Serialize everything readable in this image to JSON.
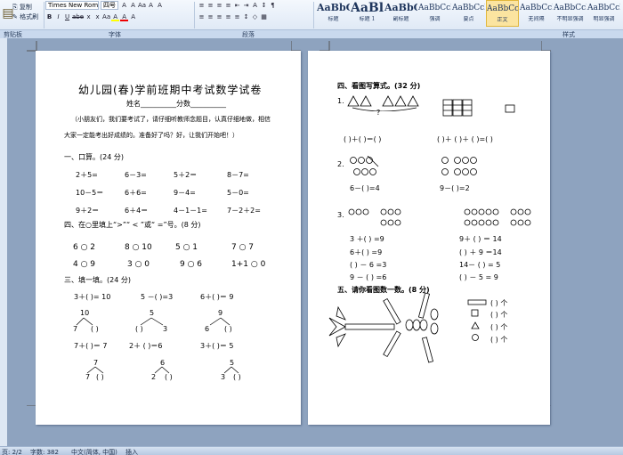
{
  "ribbon": {
    "paste_label": "粘贴",
    "copy_label": "复制",
    "format_painter_label": "格式刷",
    "font_name": "Times New Roman",
    "font_size": "四号",
    "groups": [
      "剪贴板",
      "字体",
      "段落",
      "样式"
    ],
    "font_buttons_row1": [
      "A",
      "A",
      "Aa",
      "A",
      "A"
    ],
    "font_buttons_row2": [
      "B",
      "I",
      "U",
      "abe",
      "x",
      "x",
      "Aa",
      "A",
      "A",
      "A"
    ],
    "para_buttons_row1": [
      "≡",
      "≡",
      "≡",
      "≡",
      "⇤",
      "⇥",
      "A",
      "↕",
      "¶"
    ],
    "para_buttons_row2": [
      "≡",
      "≡",
      "≡",
      "≡",
      "≡",
      "↕",
      "◇",
      "▦"
    ],
    "styles": [
      {
        "sample": "AaBbC",
        "name": "标题"
      },
      {
        "sample": "AaBl",
        "name": "标题 1"
      },
      {
        "sample": "AaBbC",
        "name": "副标题"
      },
      {
        "sample": "AaBbCcDı",
        "name": "强调"
      },
      {
        "sample": "AaBbCcD",
        "name": "要点"
      },
      {
        "sample": "AaBbCcD",
        "name": "正文"
      },
      {
        "sample": "AaBbCcDı",
        "name": "无间隔"
      },
      {
        "sample": "AaBbCcDı",
        "name": "不明显强调"
      },
      {
        "sample": "AaBbCcD",
        "name": "明显强调"
      }
    ]
  },
  "page1": {
    "title": "幼儿园(春)学前班期中考试数学试卷",
    "name_line": "姓名__________分数__________",
    "intro1": "（小朋友们，我们要考试了，请仔细听教师念题目，认真仔细地做，相信",
    "intro2": "大家一定能考出好成绩的。准备好了吗？好，让我们开始吧！）",
    "s1": "一、口算。(24 分)",
    "calc": [
      [
        "2＋5=",
        "6－3=",
        "5＋2＝",
        "8－7="
      ],
      [
        "10－5＝",
        "6＋6=",
        "9－4=",
        "5－0="
      ],
      [
        "9＋2＝",
        "6＋4＝",
        "4－1－1=",
        "7－2＋2="
      ]
    ],
    "s2": "四、在○里填上“>”“ < ”或“ =”号。(8 分)",
    "cmp": [
      [
        "6 ○ 2",
        "8 ○ 10",
        "5 ○  1",
        "7 ○ 7"
      ],
      [
        "4 ○ 9",
        "3 ○ 0",
        "9 ○ 6",
        "1+1 ○ 0"
      ]
    ],
    "s3": "三、填一填。(24 分)",
    "fill1": [
      "3＋(  )= 10",
      "5 －(   )=3",
      "6＋(   )＝ 9"
    ],
    "tree1": [
      [
        "10",
        "7",
        "(   )"
      ],
      [
        "5",
        "(   )",
        "3"
      ],
      [
        "9",
        "6",
        "(   )"
      ]
    ],
    "fill2": [
      "7＋(  )＝ 7",
      "2＋ (   )＝6",
      "3＋(  )＝ 5"
    ],
    "tree2": [
      [
        "7",
        "7",
        "(   )"
      ],
      [
        "6",
        "2",
        "(   )"
      ],
      [
        "5",
        "3",
        "(   )"
      ]
    ]
  },
  "page2": {
    "s4": "四、看图写算式。(32 分)",
    "q1": "1.",
    "q1_mark": "?",
    "q1_eq": [
      "(   )＋(   )＝(   )",
      "(   )＋ (   )＋ (   )=(   )"
    ],
    "q2": "2.",
    "q2_eq": [
      "6－(   )=4",
      "9－(   )=2"
    ],
    "q3": "3.",
    "q3_left": [
      "3 ＋(    ) =9",
      "6＋(    ) =9",
      "(    ) － 6  =3",
      "9 － (    ) =6"
    ],
    "q3_right": [
      "9＋ (     ) ＝ 14",
      "(     ) ＋ 9 ＝14",
      "14－ (     ) = 5",
      "(     ) － 5 = 9"
    ],
    "s5": "五、请你看图数一数。(8 分)",
    "count_rows": [
      "(          ) 个",
      "(          ) 个",
      "(          ) 个",
      "(          ) 个"
    ]
  },
  "status": {
    "page": "页: 2/2",
    "words": "字数: 382",
    "lang": "中文(简体, 中国)",
    "mode": "插入"
  }
}
